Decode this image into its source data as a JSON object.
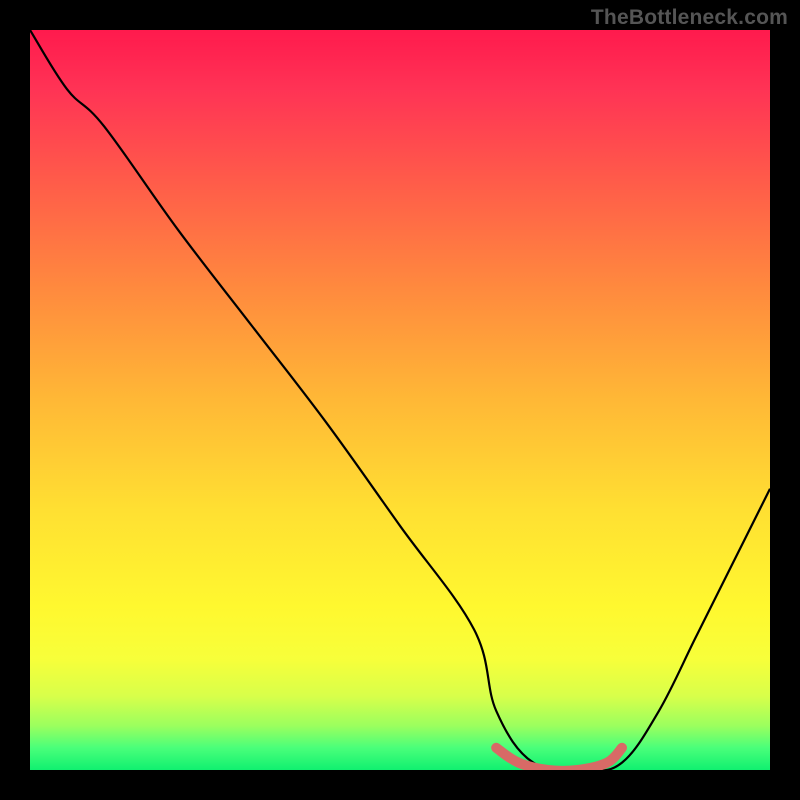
{
  "watermark": "TheBottleneck.com",
  "chart_data": {
    "type": "line",
    "title": "",
    "xlabel": "",
    "ylabel": "",
    "xlim": [
      0,
      100
    ],
    "ylim": [
      0,
      100
    ],
    "series": [
      {
        "name": "bottleneck-curve",
        "color": "#000000",
        "x": [
          0,
          5,
          10,
          20,
          30,
          40,
          50,
          60,
          63,
          68,
          75,
          80,
          85,
          90,
          95,
          100
        ],
        "values": [
          100,
          92,
          87,
          73,
          60,
          47,
          33,
          19,
          8,
          1,
          0,
          1,
          8,
          18,
          28,
          38
        ]
      },
      {
        "name": "optimal-band",
        "color": "#d86a66",
        "x": [
          63,
          66,
          70,
          74,
          78,
          80
        ],
        "values": [
          3,
          1,
          0,
          0,
          1,
          3
        ]
      }
    ],
    "annotations": []
  }
}
